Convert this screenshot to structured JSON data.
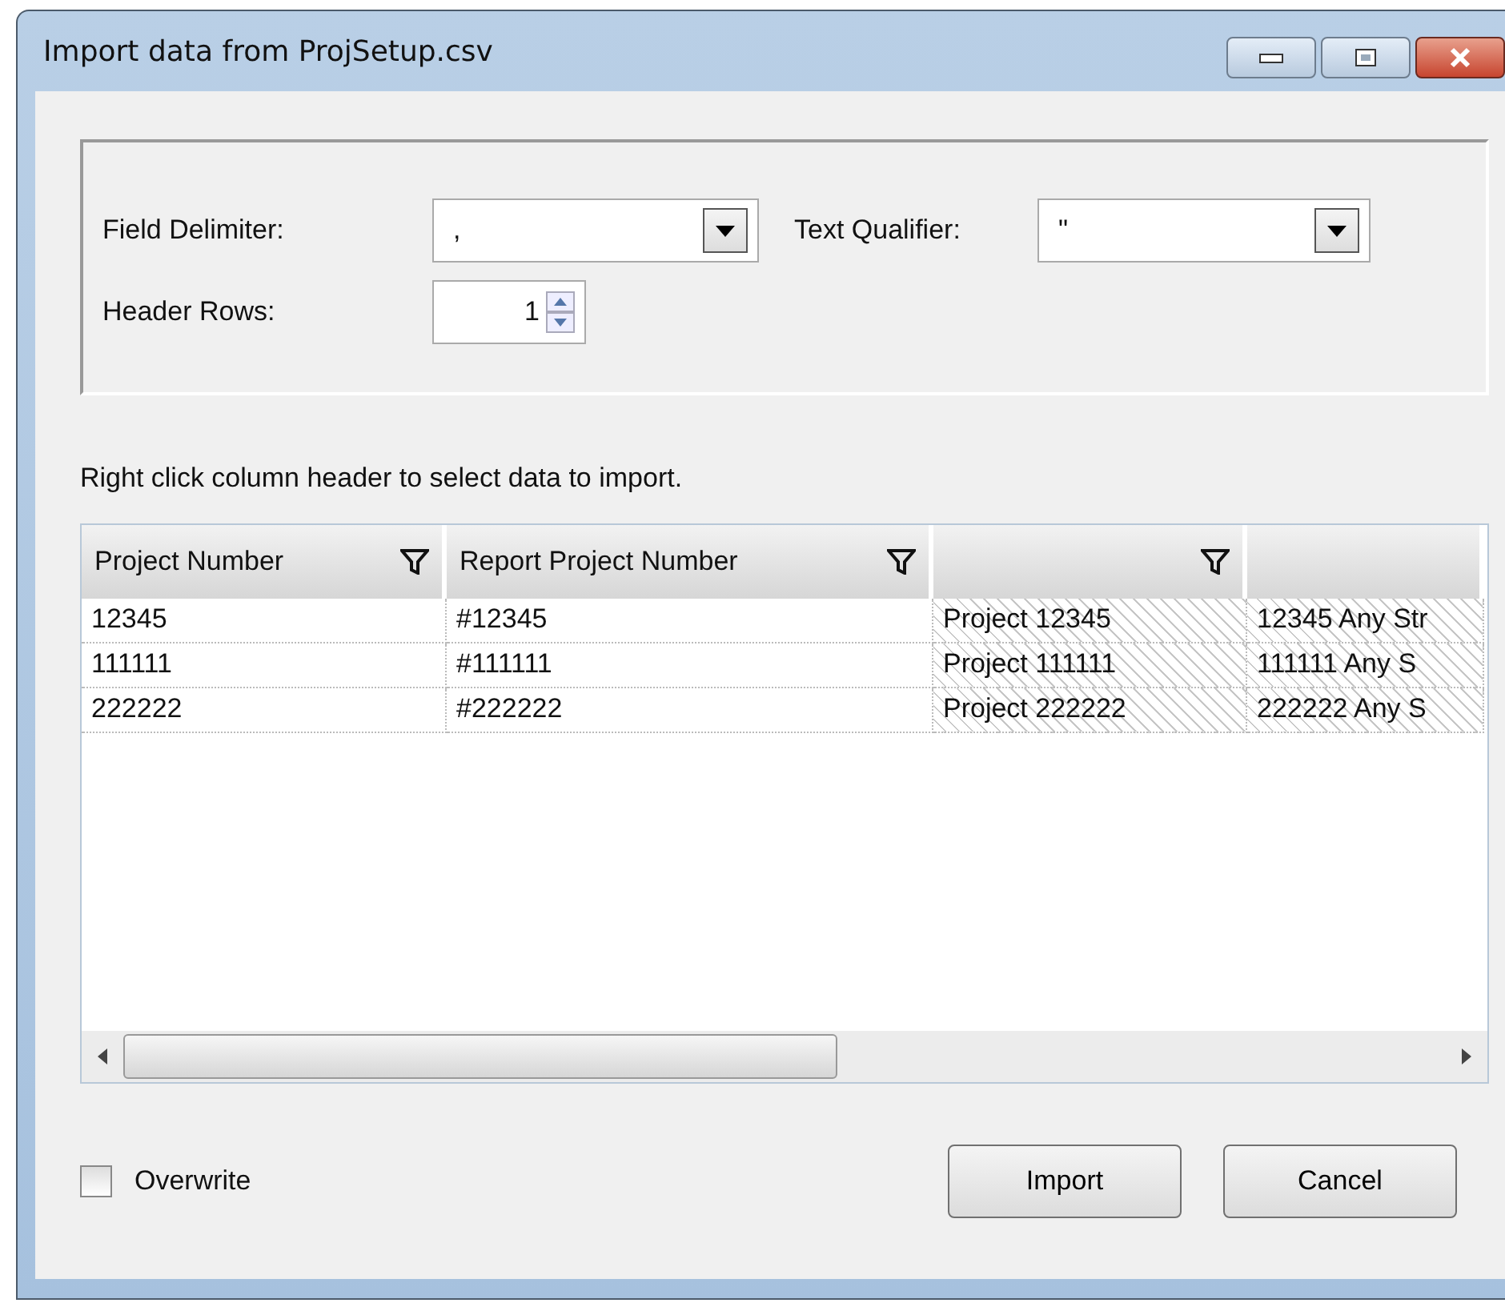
{
  "window": {
    "title": "Import data from ProjSetup.csv"
  },
  "options": {
    "field_delimiter": {
      "label": "Field Delimiter:",
      "value": ","
    },
    "text_qualifier": {
      "label": "Text Qualifier:",
      "value": "\""
    },
    "header_rows": {
      "label": "Header Rows:",
      "value": "1"
    }
  },
  "hint": "Right click column header to select data to import.",
  "table": {
    "columns": [
      {
        "label": "Project Number",
        "filter": true,
        "excluded": false
      },
      {
        "label": "Report Project Number",
        "filter": true,
        "excluded": false
      },
      {
        "filter": true,
        "excluded": true
      },
      {
        "filter": false,
        "excluded": true
      }
    ],
    "rows": [
      [
        "12345",
        "#12345",
        "Project 12345",
        "12345 Any Str"
      ],
      [
        "111111",
        "#111111",
        "Project 111111",
        "111111 Any S"
      ],
      [
        "222222",
        "#222222",
        "Project 222222",
        "222222 Any S"
      ]
    ]
  },
  "overwrite": {
    "label": "Overwrite",
    "checked": false
  },
  "buttons": [
    "Import",
    "Cancel"
  ]
}
